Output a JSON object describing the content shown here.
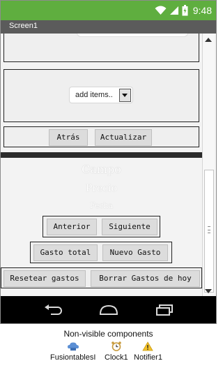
{
  "status_bar": {
    "time": "9:48"
  },
  "title_bar": {
    "title": "Screen1"
  },
  "list_picker": {
    "label": "add items.."
  },
  "nav_buttons": {
    "back": "Atrás",
    "update": "Actualizar"
  },
  "display": {
    "field": "Campo",
    "price": "Precio",
    "date": "Fecha"
  },
  "pager": {
    "previous": "Anterior",
    "next": "Siguiente"
  },
  "expenses": {
    "total": "Gasto total",
    "new": "Nuevo Gasto"
  },
  "reset": {
    "reset": "Resetear gastos",
    "delete_today": "Borrar Gastos de hoy"
  },
  "non_visible": {
    "title": "Non-visible components",
    "items": [
      {
        "name": "FusiontablesI",
        "icon": "fusiontables-icon"
      },
      {
        "name": "Clock1",
        "icon": "clock-icon"
      },
      {
        "name": "Notifier1",
        "icon": "warning-icon"
      }
    ]
  },
  "colors": {
    "status_bar": "#5fae3f",
    "title_bar": "#5b5b5b",
    "nav_bar": "#000000"
  }
}
